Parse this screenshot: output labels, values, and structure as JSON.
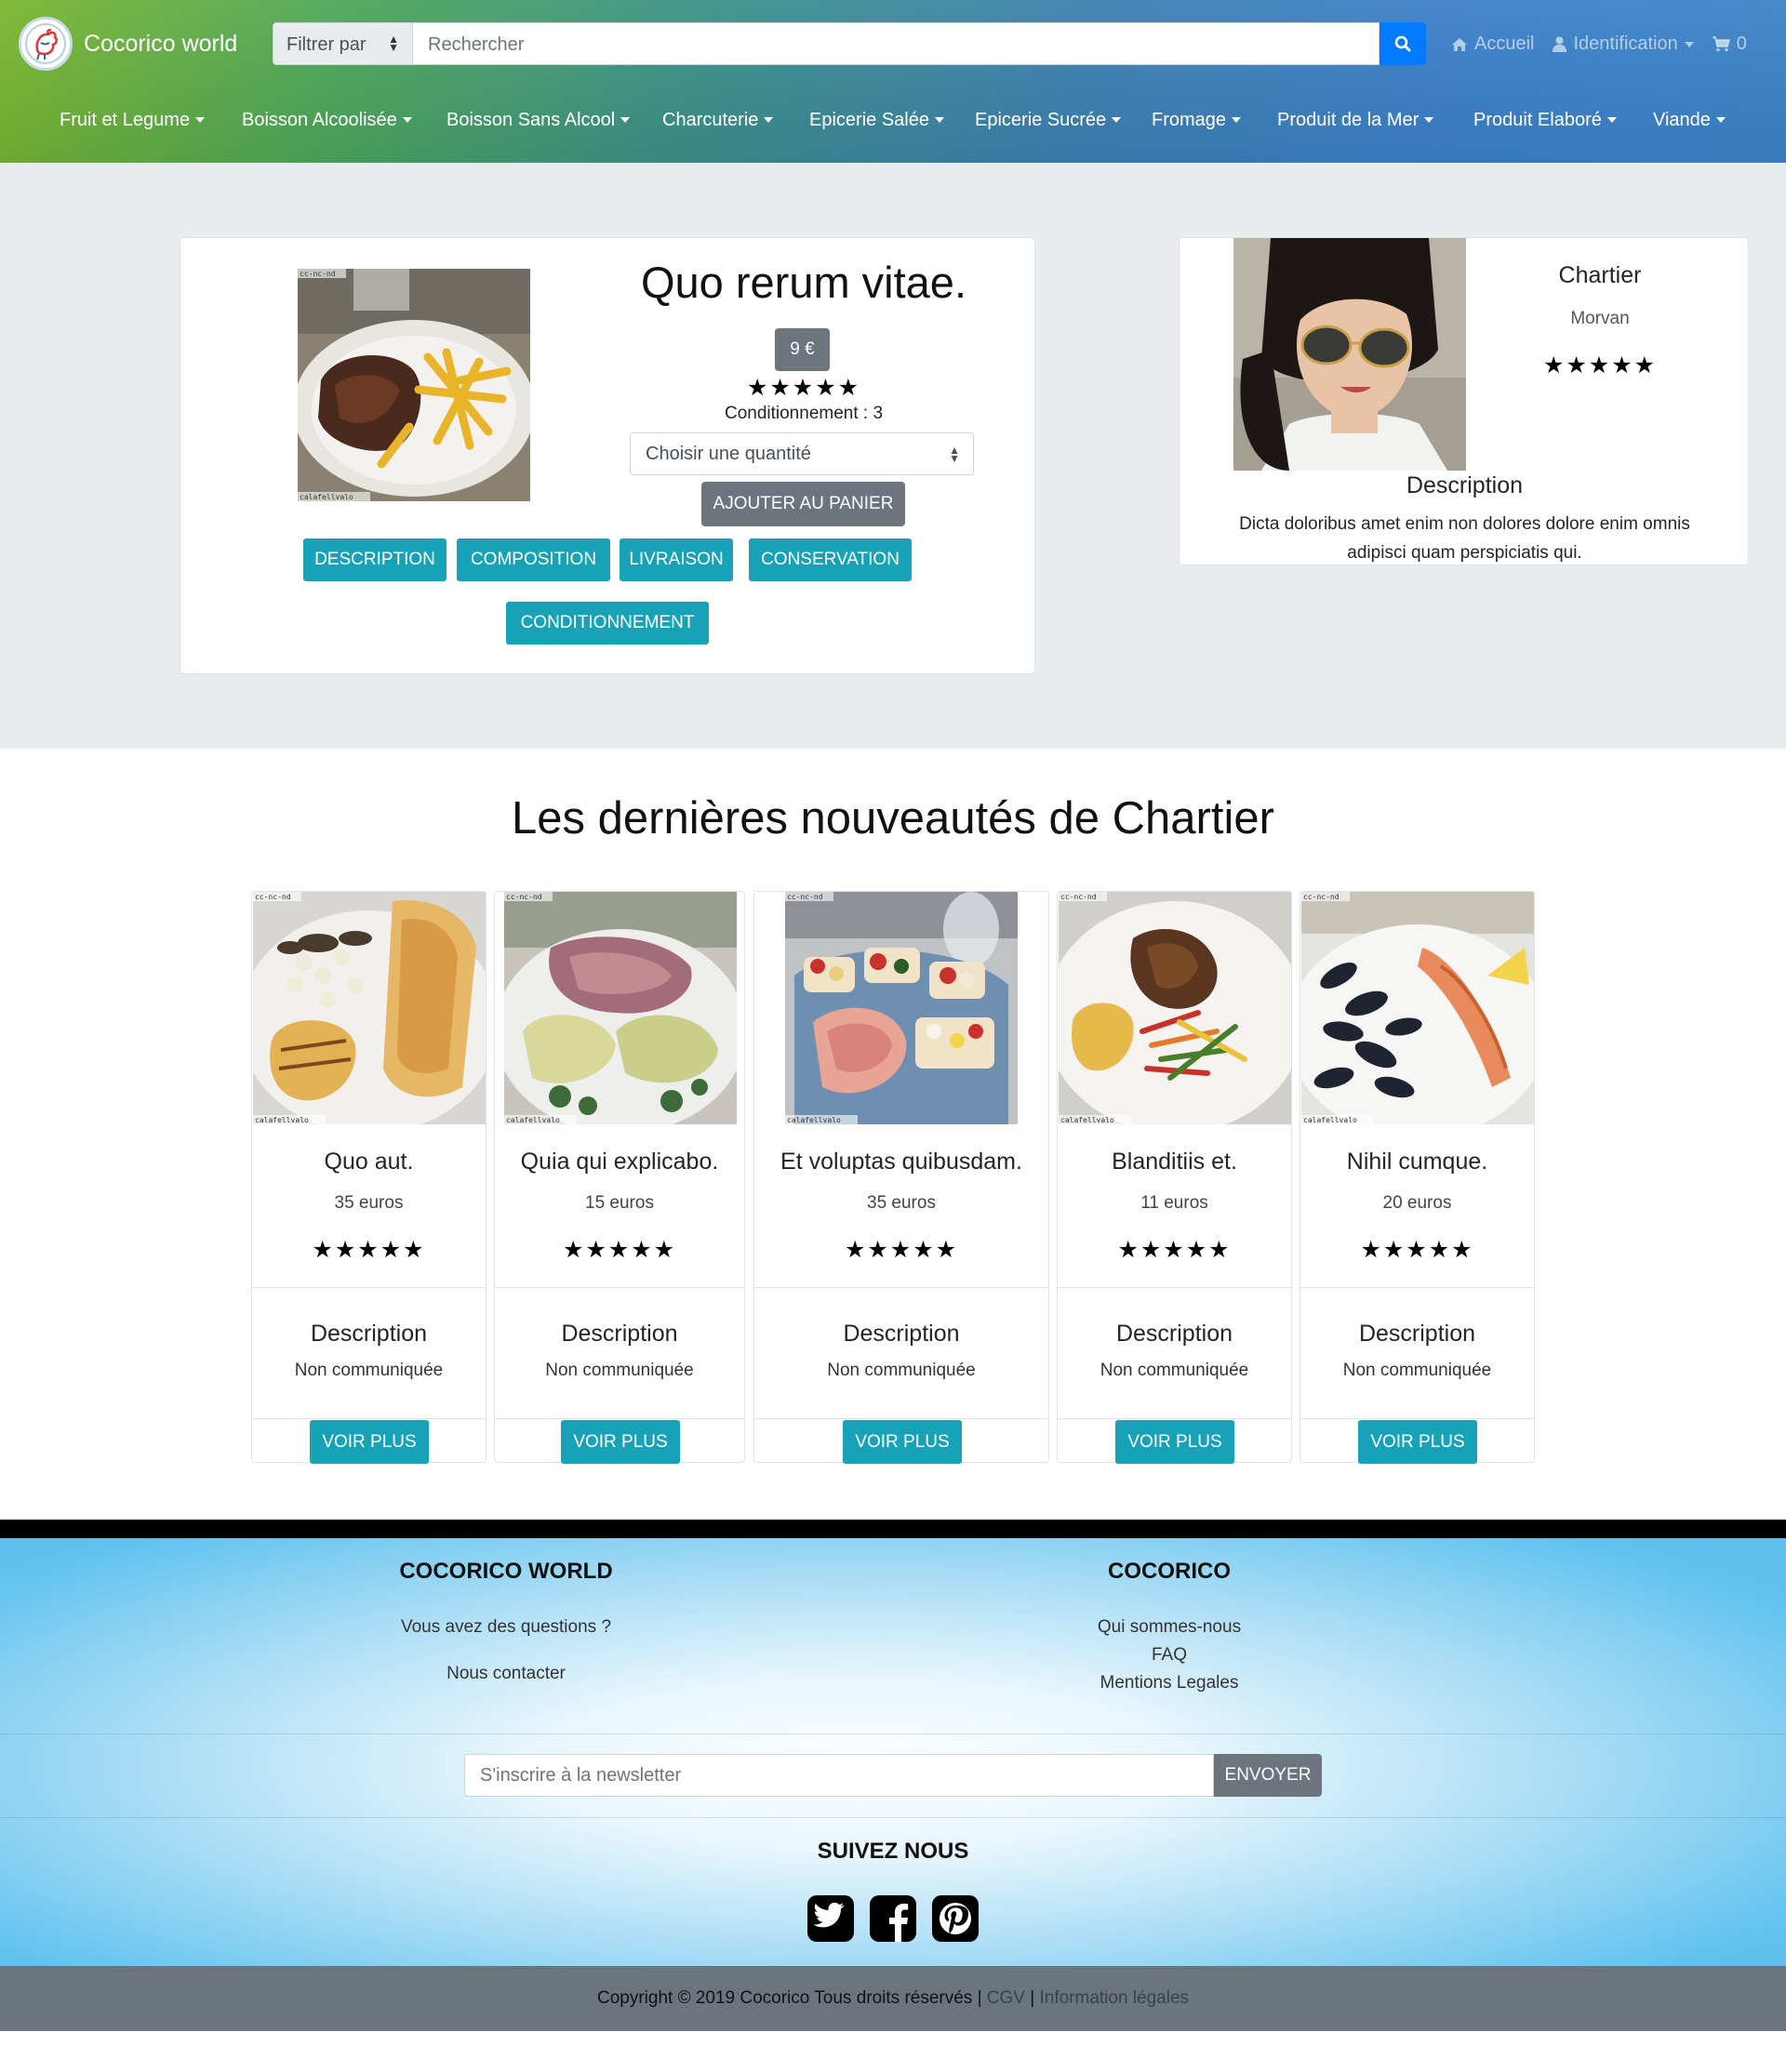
{
  "header": {
    "brand": "Cocorico world",
    "filter_label": "Filtrer par",
    "search_placeholder": "Rechercher",
    "nav": {
      "home": "Accueil",
      "login": "Identification",
      "cart_count": "0"
    },
    "categories": [
      "Fruit et Legume",
      "Boisson Alcoolisée",
      "Boisson Sans Alcool",
      "Charcuterie",
      "Epicerie Salée",
      "Epicerie Sucrée",
      "Fromage",
      "Produit de la Mer",
      "Produit Elaboré",
      "Viande"
    ]
  },
  "product": {
    "title": "Quo rerum vitae.",
    "price": "9 €",
    "stars": "★★★★★",
    "rating": 5,
    "conditioning": "Conditionnement : 3",
    "quantity_placeholder": "Choisir une quantité",
    "add_to_cart": "AJOUTER AU PANIER",
    "image_watermark_top": "cc-nc-nd",
    "image_watermark_bottom": "calafellvalo",
    "tabs": [
      "DESCRIPTION",
      "COMPOSITION",
      "LIVRAISON",
      "CONSERVATION",
      "CONDITIONNEMENT"
    ]
  },
  "seller": {
    "name": "Chartier",
    "subname": "Morvan",
    "stars": "★★★★★",
    "rating": 5,
    "description_title": "Description",
    "description": "Dicta doloribus amet enim non dolores dolore enim omnis adipisci quam perspiciatis qui."
  },
  "latest": {
    "title": "Les dernières nouveautés de Chartier",
    "description_title": "Description",
    "description_value": "Non communiquée",
    "more_label": "VOIR PLUS",
    "items": [
      {
        "name": "Quo aut.",
        "price": "35 euros",
        "stars": "★★★★★"
      },
      {
        "name": "Quia qui explicabo.",
        "price": "15 euros",
        "stars": "★★★★★"
      },
      {
        "name": "Et voluptas quibusdam.",
        "price": "35 euros",
        "stars": "★★★★★"
      },
      {
        "name": "Blanditiis et.",
        "price": "11 euros",
        "stars": "★★★★★"
      },
      {
        "name": "Nihil cumque.",
        "price": "20 euros",
        "stars": "★★★★★"
      }
    ]
  },
  "footer": {
    "col1_title": "COCORICO WORLD",
    "col1_question": "Vous avez des questions ?",
    "col1_contact": "Nous contacter",
    "col2_title": "COCORICO",
    "col2_links": [
      "Qui sommes-nous",
      "FAQ",
      "Mentions Legales"
    ],
    "newsletter_placeholder": "S'inscrire à la newsletter",
    "newsletter_button": "ENVOYER",
    "follow_title": "SUIVEZ NOUS",
    "copyright": "Copyright © 2019 Cocorico Tous droits réservés |",
    "cgv": "CGV",
    "separator": "|",
    "legal": "Information légales"
  },
  "colors": {
    "info": "#17a2b8",
    "secondary": "#6c757d",
    "primary": "#007bff",
    "hero_bg": "#e9ecef"
  }
}
